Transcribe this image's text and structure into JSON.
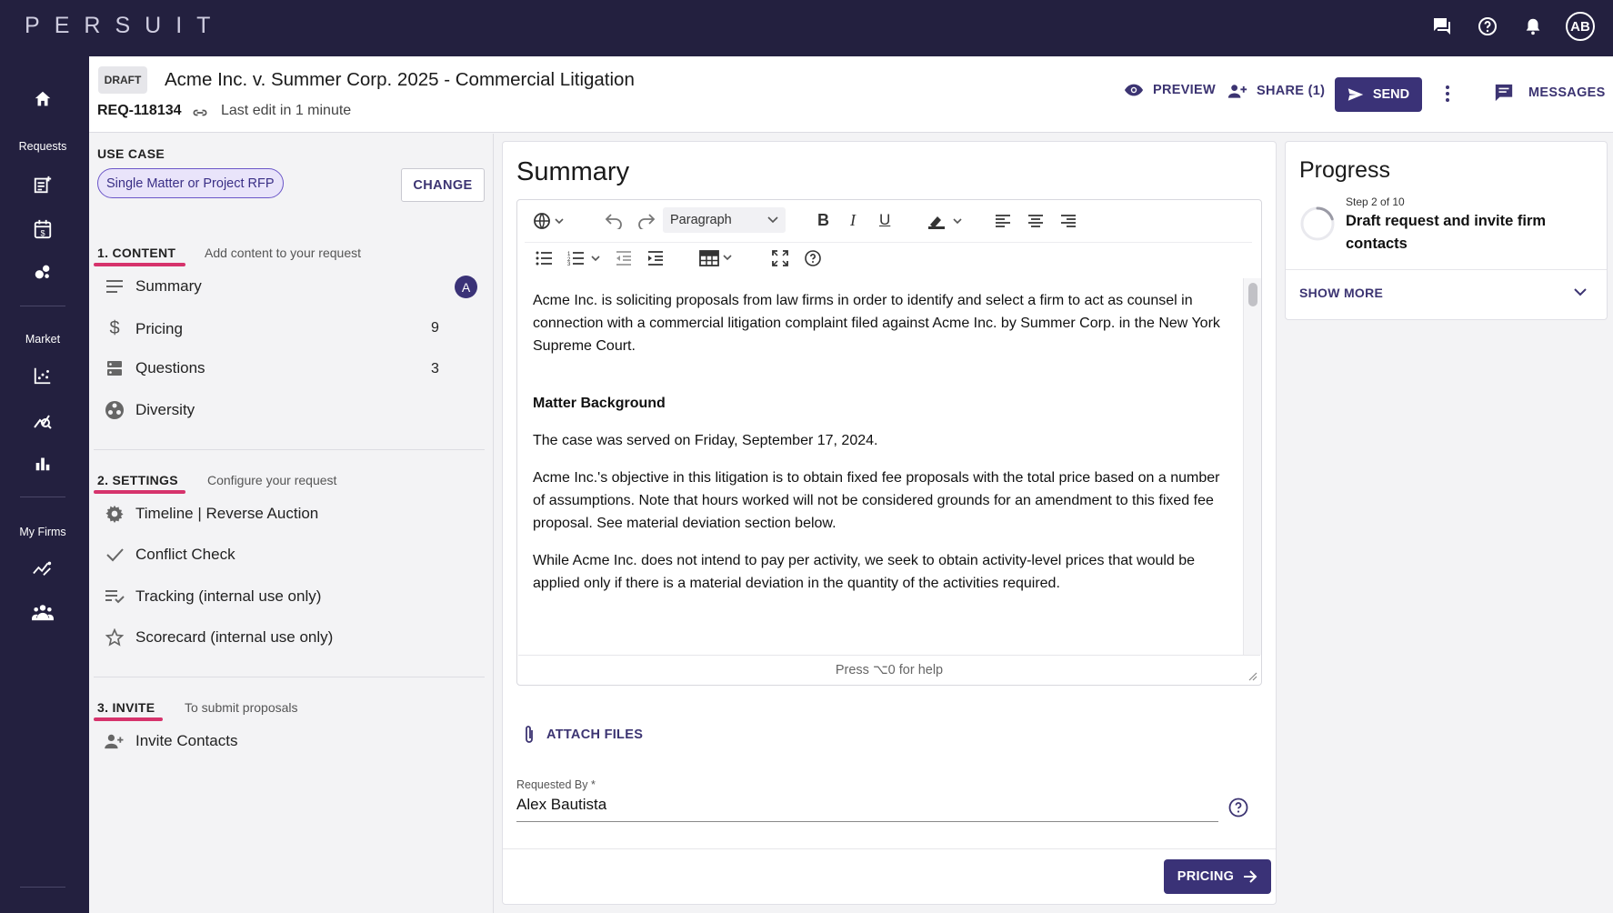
{
  "app": {
    "logo_letters": [
      "P",
      "E",
      "R",
      "S",
      "U",
      "I",
      "T"
    ]
  },
  "nav": {
    "requests": "Requests",
    "market": "Market",
    "my_firms": "My Firms"
  },
  "topbar": {
    "avatar": "AB"
  },
  "header": {
    "badge": "DRAFT",
    "title": "Acme Inc. v. Summer Corp. 2025 - Commercial Litigation",
    "req_id": "REQ-118134",
    "last_edit": "Last edit in 1 minute",
    "preview": "PREVIEW",
    "share": "SHARE (1)",
    "send": "SEND",
    "messages": "MESSAGES"
  },
  "use_case": {
    "label": "USE CASE",
    "value": "Single Matter or Project RFP",
    "change": "CHANGE"
  },
  "sections": {
    "content": {
      "title": "1. CONTENT",
      "subtitle": "Add content to your request",
      "items": [
        {
          "label": "Summary",
          "badge": "A"
        },
        {
          "label": "Pricing",
          "count": "9"
        },
        {
          "label": "Questions",
          "count": "3"
        },
        {
          "label": "Diversity"
        }
      ]
    },
    "settings": {
      "title": "2. SETTINGS",
      "subtitle": "Configure your request",
      "items": [
        {
          "label": "Timeline | Reverse Auction"
        },
        {
          "label": "Conflict Check"
        },
        {
          "label": "Tracking (internal use only)"
        },
        {
          "label": "Scorecard (internal use only)"
        }
      ]
    },
    "invite": {
      "title": "3. INVITE",
      "subtitle": "To submit proposals",
      "items": [
        {
          "label": "Invite Contacts"
        }
      ]
    }
  },
  "summary": {
    "title": "Summary",
    "toolbar": {
      "paragraph": "Paragraph"
    },
    "content": {
      "p1": "Acme Inc. is soliciting proposals from law firms in order to identify and select a firm to act as counsel in connection with a commercial litigation complaint filed against Acme Inc. by Summer Corp. in the New York Supreme Court.",
      "h1": "Matter Background",
      "p2": "The case was served on Friday, September 17, 2024.",
      "p3": "Acme Inc.'s objective in this litigation is to obtain fixed fee proposals with the total price based on a number of assumptions. Note that hours worked will not be considered grounds for an amendment to this fixed fee proposal. See material deviation section below.",
      "p4": "While Acme Inc. does not intend to pay per activity, we seek to obtain activity-level prices that would be applied only if there is a material deviation in the quantity of the activities required."
    },
    "help": "Press ⌥0 for help",
    "attach": "ATTACH FILES",
    "requested_by_label": "Requested By *",
    "requested_by": "Alex Bautista",
    "next": "PRICING"
  },
  "progress": {
    "title": "Progress",
    "step": "Step 2 of 10",
    "fraction": 0.2,
    "desc": "Draft request and invite firm contacts",
    "show_more": "SHOW MORE"
  }
}
